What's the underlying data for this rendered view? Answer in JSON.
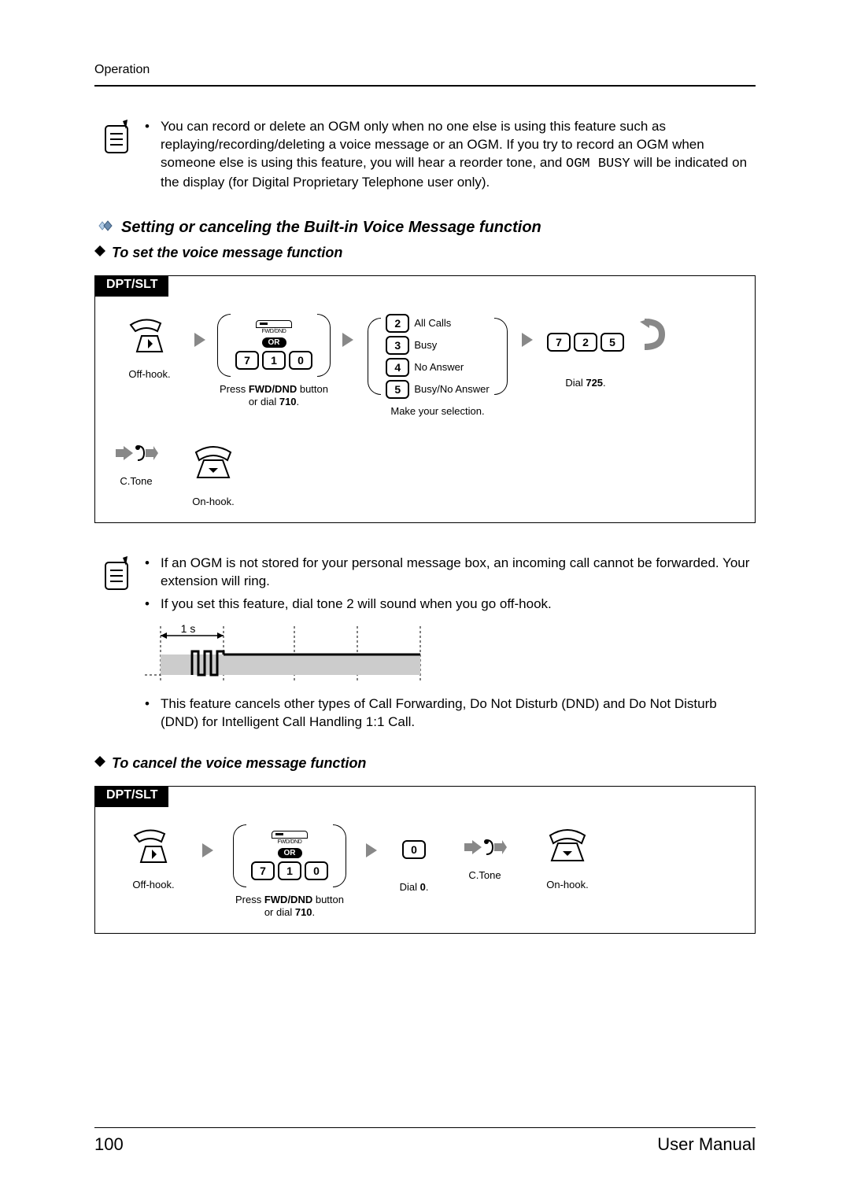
{
  "header": {
    "running": "Operation"
  },
  "note1": {
    "bullets": [
      {
        "pre": "You can record or delete an OGM only when no one else is using this feature such as replaying/recording/deleting a voice message or an OGM. If you try to record an OGM when someone else is using this feature, you will hear a reorder tone, and ",
        "code": "OGM BUSY",
        "post": " will be indicated on the display (for Digital Proprietary Telephone user only)."
      }
    ]
  },
  "heading1": "Setting or canceling the Built-in Voice Message function",
  "heading2a": "To set the voice message function",
  "heading2b": "To cancel the voice message function",
  "dpt_label": "DPT/SLT",
  "set_flow": {
    "step_offhook": "Off-hook.",
    "fwddnd_label": "FWD/DND",
    "or_label": "OR",
    "keys710": [
      "7",
      "1",
      "0"
    ],
    "step_fwddnd_pre": "Press ",
    "step_fwddnd_bold": "FWD/DND",
    "step_fwddnd_mid": " button\nor dial ",
    "step_fwddnd_bold2": "710",
    "step_fwddnd_end": ".",
    "selections": [
      {
        "k": "2",
        "t": "All Calls"
      },
      {
        "k": "3",
        "t": "Busy"
      },
      {
        "k": "4",
        "t": "No Answer"
      },
      {
        "k": "5",
        "t": "Busy/No Answer"
      }
    ],
    "step_selection": "Make  your selection.",
    "keys725": [
      "7",
      "2",
      "5"
    ],
    "step725_pre": "Dial ",
    "step725_bold": "725",
    "step725_end": ".",
    "ctone": "C.Tone",
    "onhook": "On-hook."
  },
  "note2": {
    "b1": "If an OGM is not stored for your personal message box, an incoming call cannot be forwarded. Your extension will ring.",
    "b2": "If you set this feature, dial tone 2 will sound when you go off-hook.",
    "b3": "This feature cancels other types of Call Forwarding, Do Not Disturb (DND) and Do Not Disturb (DND) for Intelligent Call Handling 1:1 Call.",
    "dialtone_label": "1 s"
  },
  "cancel_flow": {
    "step_offhook": "Off-hook.",
    "fwddnd_label": "FWD/DND",
    "or_label": "OR",
    "keys710": [
      "7",
      "1",
      "0"
    ],
    "step_fwddnd_pre": "Press ",
    "step_fwddnd_bold": "FWD/DND",
    "step_fwddnd_mid": " button\nor dial ",
    "step_fwddnd_bold2": "710",
    "step_fwddnd_end": ".",
    "key0": "0",
    "step0_pre": "Dial ",
    "step0_bold": "0",
    "step0_end": ".",
    "ctone": "C.Tone",
    "onhook": "On-hook."
  },
  "footer": {
    "page": "100",
    "title": "User Manual"
  }
}
